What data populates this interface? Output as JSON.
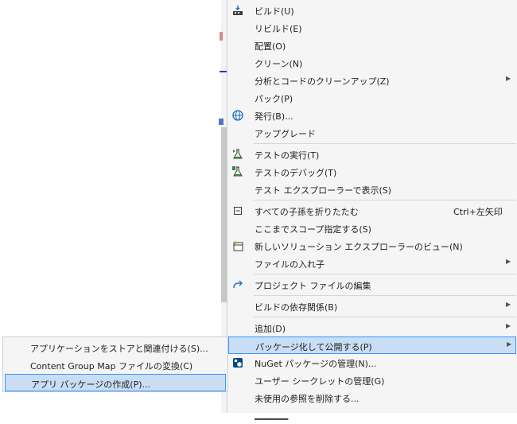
{
  "menu": {
    "items": [
      {
        "label": "ビルド(U)",
        "icon": "build-icon"
      },
      {
        "label": "リビルド(E)"
      },
      {
        "label": "配置(O)"
      },
      {
        "label": "クリーン(N)"
      },
      {
        "label": "分析とコードのクリーンアップ(Z)",
        "submenu": true
      },
      {
        "label": "パック(P)"
      },
      {
        "label": "発行(B)...",
        "icon": "globe-icon"
      },
      {
        "label": "アップグレード"
      },
      {
        "label": "テストの実行(T)",
        "icon": "flask-run-icon"
      },
      {
        "label": "テストのデバッグ(T)",
        "icon": "flask-debug-icon"
      },
      {
        "label": "テスト エクスプローラーで表示(S)"
      },
      {
        "label": "すべての子孫を折りたたむ",
        "shortcut": "Ctrl+左矢印",
        "icon": "collapse-icon"
      },
      {
        "label": "ここまでスコープ指定する(S)"
      },
      {
        "label": "新しいソリューション エクスプローラーのビュー(N)",
        "icon": "new-view-icon"
      },
      {
        "label": "ファイルの入れ子",
        "submenu": true
      },
      {
        "label": "プロジェクト ファイルの編集",
        "icon": "redo-arrow-icon"
      },
      {
        "label": "ビルドの依存関係(B)",
        "submenu": true
      },
      {
        "label": "追加(D)",
        "submenu": true
      },
      {
        "label": "パッケージ化して公開する(P)",
        "submenu": true,
        "highlighted": true
      },
      {
        "label": "NuGet パッケージの管理(N)...",
        "icon": "nuget-icon"
      },
      {
        "label": "ユーザー シークレットの管理(G)"
      },
      {
        "label": "未使用の参照を削除する..."
      }
    ]
  },
  "submenu": {
    "items": [
      {
        "label": "アプリケーションをストアと関連付ける(S)..."
      },
      {
        "label": "Content Group Map ファイルの変換(C)"
      },
      {
        "label": "アプリ パッケージの作成(P)...",
        "highlighted": true
      }
    ]
  },
  "colors": {
    "highlight": "#c9def5",
    "highlight_border": "#3399ff",
    "menu_bg": "#f5f5f5"
  }
}
